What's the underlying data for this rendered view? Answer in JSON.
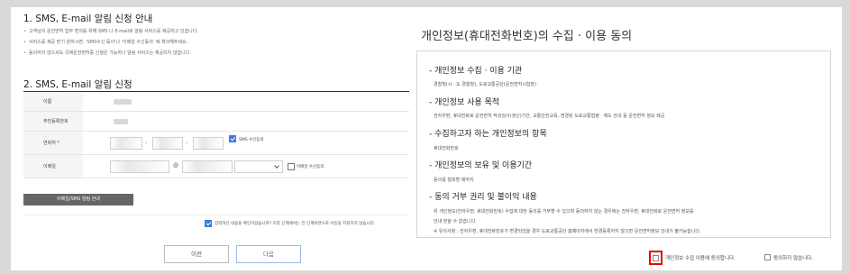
{
  "left": {
    "section1_title": "1. SMS, E-mail 알림 신청 안내",
    "notes": [
      "고객님의 운전면허 업무 편의를 위해 SMS 나 E-mail로 알림 서비스를 제공하고 있습니다.",
      "서비스를 제공 받기 원하시면, 'SMS수신 동의'나 '이메일 수신동의' 에 체크해주세요.",
      "동의하지 않으셔도 국제운전면허증 신청은 가능하나 알림 서비스는 제공되지 않습니다."
    ],
    "section2_title": "2. SMS, E-mail 알림 신청",
    "form": {
      "name_label": "이름",
      "rrn_label": "주민등록번호",
      "mobile_label": "연락처 *",
      "sms_consent_label": "SMS 수신동의",
      "email_label": "이메일",
      "email_at": "@",
      "email_consent_label": "이메일 수신동의",
      "mobile_dash": "-"
    },
    "guide_button": "이메일/SMS 알림 안내",
    "confirm_text": "입력하신 내용을 확인하셨습니까? 이후 단계에서는 전 단계화면으로 이동을 지원하지 않습니다.",
    "prev_button": "이전",
    "next_button": "다음"
  },
  "right": {
    "title": "개인정보(휴대전화번호)의 수집 · 이용 동의",
    "sections": [
      {
        "heading": "개인정보 수집 · 이용 기관",
        "body": [
          "경찰청(시 · 도 경찰청), 도로교통공단(운전면허시험장)"
        ]
      },
      {
        "heading": "개인정보 사용 목적",
        "body": [
          "전자우편, 휴대전화로 운전면허 적성검사(갱신)기간, 교통안전교육, 변경된 도로교통법령 · 제도 안내 등 운전면허 정보 제공"
        ]
      },
      {
        "heading": "수집하고자 하는 개인정보의 항목",
        "body": [
          "휴대전화번호"
        ]
      },
      {
        "heading": "개인정보의 보유 및 이용기간",
        "body": [
          "동의를 철회할 때까지"
        ]
      },
      {
        "heading": "동의 거부 권리 및 불이익 내용",
        "body": [
          "위 개인정보(전자우편, 휴대전화번호) 수집에 대한 동의를 거부할 수 있으며 동의하지 않는 경우에는 전자우편, 휴대전화로 운전면허 정보를",
          "안내 받을 수 없습니다.",
          "※ 유의사항 : 전자우편, 휴대전화번호가 변경되었을 경우 도로교통공단 홈페이지에서 변경등록하지 않으면 운전면허정보 안내가 불가능합니다."
        ]
      }
    ],
    "agree_label": "개인정보 수집 이용에 동의합니다.",
    "disagree_label": "동의하지 않습니다."
  }
}
